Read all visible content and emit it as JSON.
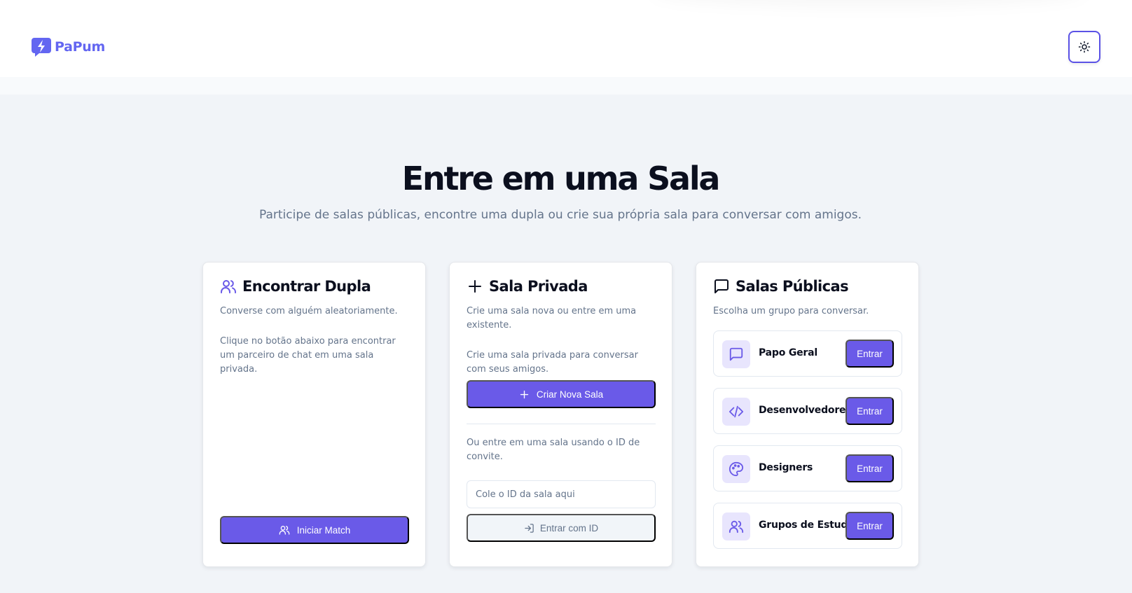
{
  "app": {
    "name": "PaPum",
    "accent": "#6a5ae8",
    "logo_color": "#6366f1"
  },
  "header": {
    "theme_toggle_icon": "sun-icon"
  },
  "hero": {
    "title": "Entre em uma Sala",
    "subtitle": "Participe de salas públicas, encontre uma dupla ou crie sua própria sala para conversar com amigos."
  },
  "match_card": {
    "icon": "users-icon",
    "title": "Encontrar Dupla",
    "subtitle": "Converse com alguém aleatoriamente.",
    "description": "Clique no botão abaixo para encontrar um parceiro de chat em uma sala privada.",
    "button_label": "Iniciar Match"
  },
  "private_card": {
    "icon": "plus-icon",
    "title": "Sala Privada",
    "subtitle": "Crie uma sala nova ou entre em uma existente.",
    "description": "Crie uma sala privada para conversar com seus amigos.",
    "create_button_label": "Criar Nova Sala",
    "join_text": "Ou entre em uma sala usando o ID de convite.",
    "id_input_value": "",
    "id_input_placeholder": "Cole o ID da sala aqui",
    "join_button_label": "Entrar com ID"
  },
  "public_card": {
    "icon": "message-square-icon",
    "title": "Salas Públicas",
    "subtitle": "Escolha um grupo para conversar.",
    "rooms": [
      {
        "name": "Papo Geral",
        "icon": "message-square-icon",
        "button": "Entrar"
      },
      {
        "name": "Desenvolvedores",
        "icon": "code-icon",
        "button": "Entrar"
      },
      {
        "name": "Designers",
        "icon": "palette-icon",
        "button": "Entrar"
      },
      {
        "name": "Grupos de Estudo",
        "icon": "users-icon",
        "button": "Entrar"
      }
    ]
  }
}
